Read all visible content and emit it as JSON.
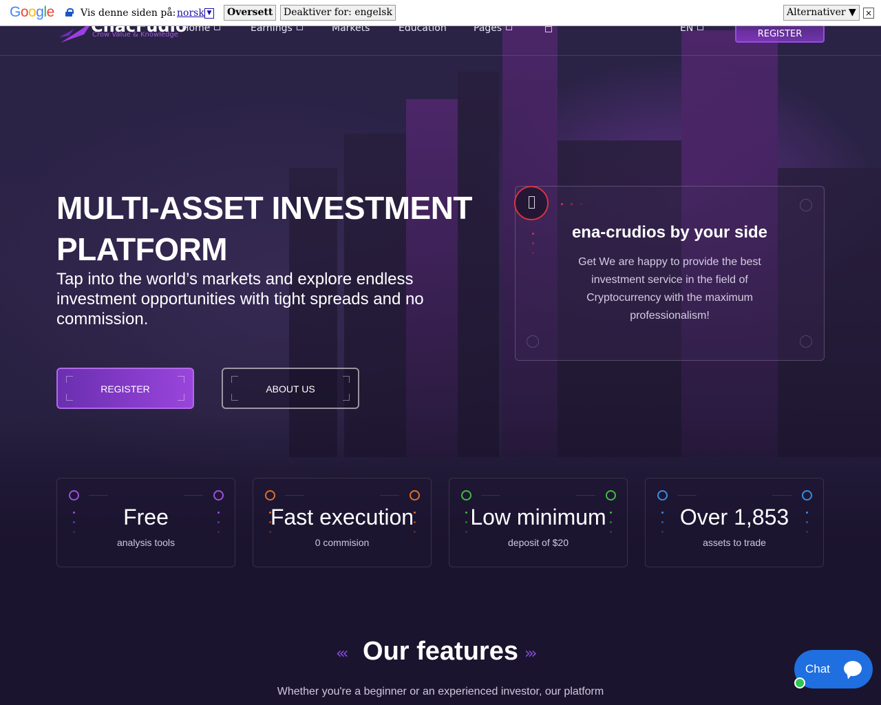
{
  "translate_bar": {
    "logo": "Google",
    "prompt": "Vis denne siden på:",
    "language": "norsk",
    "translate_button": "Oversett",
    "disable_button": "Deaktiver for: engelsk",
    "options_button": "Alternativer ▼",
    "close": "×"
  },
  "nav": {
    "brand_name": "ChacFudio",
    "brand_tagline": "Crow Value & Knowledge",
    "items": [
      {
        "label": "Home"
      },
      {
        "label": "Earnings"
      },
      {
        "label": "Markets"
      },
      {
        "label": "Education"
      },
      {
        "label": "Pages"
      }
    ],
    "language": "EN",
    "register": "REGISTER"
  },
  "hero": {
    "title": "MULTI-ASSET INVESTMENT PLATFORM",
    "subtitle": "Tap into the world’s markets and explore endless investment opportunities with tight spreads and no commission.",
    "register_button": "REGISTER",
    "about_button": "ABOUT US"
  },
  "info_card": {
    "title": "ena-crudios by your side",
    "text": "Get We are happy to provide the best investment service in the field of Cryptocurrency with the maximum professionalism!"
  },
  "stats": [
    {
      "big": "Free",
      "small": "analysis tools",
      "color": "#a050e0"
    },
    {
      "big": "Fast execution",
      "small": "0 commision",
      "color": "#e0702a"
    },
    {
      "big": "Low minimum",
      "small": "deposit of $20",
      "color": "#3cc23a"
    },
    {
      "big": "Over 1,853",
      "small": "assets to trade",
      "color": "#3a8ee6"
    }
  ],
  "features": {
    "title": "Our features",
    "subtitle": "Whether you're a beginner or an experienced investor, our platform"
  },
  "chat": {
    "label": "Chat"
  }
}
